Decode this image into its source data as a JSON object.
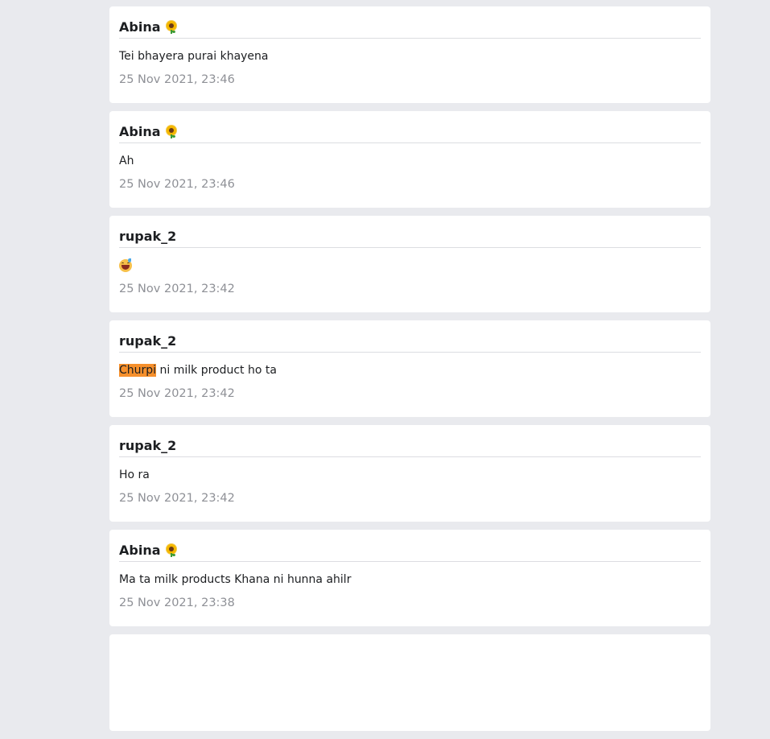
{
  "messages": [
    {
      "username": "",
      "has_emoji": false,
      "body": "",
      "timestamp": ""
    },
    {
      "username": "Abina",
      "has_emoji": true,
      "emoji_icon": "sunflower-icon",
      "body": "Tei bhayera purai khayena",
      "timestamp": "25 Nov 2021, 23:46"
    },
    {
      "username": "Abina",
      "has_emoji": true,
      "emoji_icon": "sunflower-icon",
      "body": "Ah",
      "timestamp": "25 Nov 2021, 23:46"
    },
    {
      "username": "rupak_2",
      "has_emoji": false,
      "body_icon": "grinning-sweat-icon",
      "body": "",
      "timestamp": "25 Nov 2021, 23:42"
    },
    {
      "username": "rupak_2",
      "has_emoji": false,
      "body_highlight": "Churpi",
      "body": " ni milk product ho ta",
      "highlight_color": "#f6902c",
      "timestamp": "25 Nov 2021, 23:42"
    },
    {
      "username": "rupak_2",
      "has_emoji": false,
      "body": "Ho ra",
      "timestamp": "25 Nov 2021, 23:42"
    },
    {
      "username": "Abina",
      "has_emoji": true,
      "emoji_icon": "sunflower-icon",
      "body": "Ma ta milk products Khana ni hunna ahilr",
      "timestamp": "25 Nov 2021, 23:38"
    },
    {
      "username": "",
      "has_emoji": false,
      "body": "",
      "timestamp": ""
    }
  ],
  "colors": {
    "page_background": "#e9eaee",
    "card_background": "#ffffff",
    "timestamp": "#8e9096",
    "highlight": "#f6902c"
  }
}
